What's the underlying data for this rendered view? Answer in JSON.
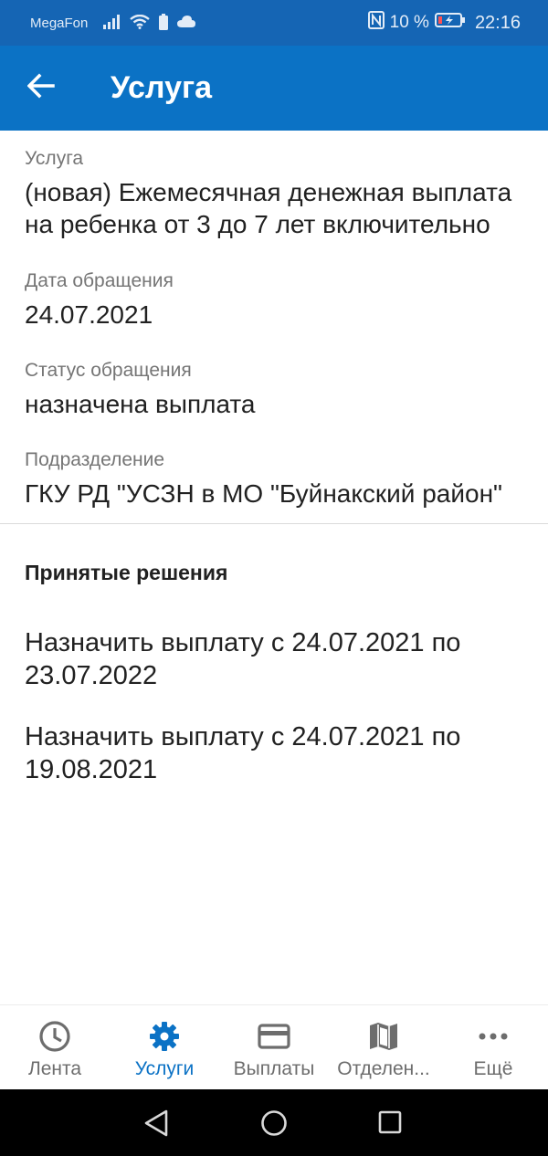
{
  "status_bar": {
    "carrier": "MegaFon",
    "battery_percent": "10 %",
    "time": "22:16"
  },
  "app_bar": {
    "title": "Услуга"
  },
  "details": {
    "service_label": "Услуга",
    "service_value": "(новая) Ежемесячная денежная выплата на ребенка от 3 до 7 лет включительно",
    "date_label": "Дата обращения",
    "date_value": "24.07.2021",
    "status_label": "Статус обращения",
    "status_value": "назначена выплата",
    "department_label": "Подразделение",
    "department_value": "ГКУ РД \"УСЗН в МО \"Буйнакский район\""
  },
  "decisions": {
    "title": "Принятые решения",
    "items": [
      "Назначить выплату с 24.07.2021 по 23.07.2022",
      "Назначить выплату с 24.07.2021 по 19.08.2021"
    ]
  },
  "bottom_nav": {
    "items": [
      {
        "label": "Лента",
        "icon": "clock-icon"
      },
      {
        "label": "Услуги",
        "icon": "gear-icon",
        "active": true
      },
      {
        "label": "Выплаты",
        "icon": "credit-card-icon"
      },
      {
        "label": "Отделен...",
        "icon": "map-icon"
      },
      {
        "label": "Ещё",
        "icon": "more-dots-icon"
      }
    ]
  },
  "colors": {
    "status_bar": "#1565b4",
    "app_bar": "#0b72c5",
    "accent": "#0b72c5",
    "nav_inactive": "#6d6d6d"
  }
}
